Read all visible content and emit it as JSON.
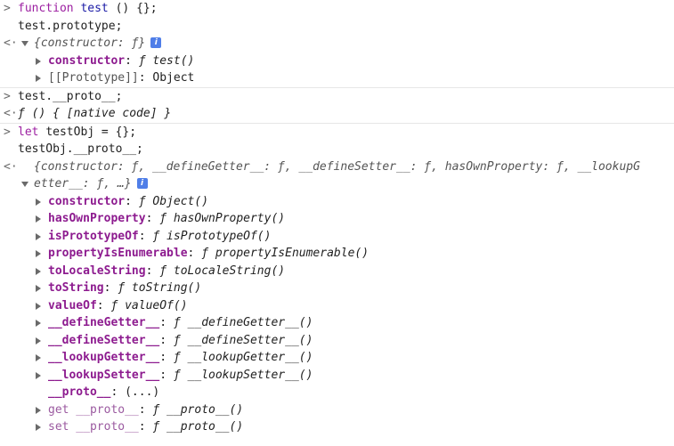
{
  "prompt_symbol": ">",
  "result_symbol": "<·",
  "badge_letter": "i",
  "entries": [
    {
      "input": [
        "function test () {};",
        "test.prototype;"
      ],
      "result_summary": "{constructor: ƒ}",
      "children": [
        {
          "key": "constructor",
          "sep": ": ",
          "value": "ƒ test()"
        },
        {
          "key": "[[Prototype]]",
          "sep": ": ",
          "value": "Object"
        }
      ]
    },
    {
      "input": [
        "test.__proto__;"
      ],
      "result": "ƒ () { [native code] }"
    },
    {
      "input": [
        "let testObj = {};",
        "testObj.__proto__;"
      ],
      "result_summary_line1": "{constructor: ƒ, __defineGetter__: ƒ, __defineSetter__: ƒ, hasOwnProperty: ƒ, __lookupG",
      "result_summary_line2": "etter__: ƒ, …}",
      "children": [
        {
          "key": "constructor",
          "sep": ": ",
          "value": "ƒ Object()"
        },
        {
          "key": "hasOwnProperty",
          "sep": ": ",
          "value": "ƒ hasOwnProperty()"
        },
        {
          "key": "isPrototypeOf",
          "sep": ": ",
          "value": "ƒ isPrototypeOf()"
        },
        {
          "key": "propertyIsEnumerable",
          "sep": ": ",
          "value": "ƒ propertyIsEnumerable()"
        },
        {
          "key": "toLocaleString",
          "sep": ": ",
          "value": "ƒ toLocaleString()"
        },
        {
          "key": "toString",
          "sep": ": ",
          "value": "ƒ toString()"
        },
        {
          "key": "valueOf",
          "sep": ": ",
          "value": "ƒ valueOf()"
        },
        {
          "key": "__defineGetter__",
          "sep": ": ",
          "value": "ƒ __defineGetter__()"
        },
        {
          "key": "__defineSetter__",
          "sep": ": ",
          "value": "ƒ __defineSetter__()"
        },
        {
          "key": "__lookupGetter__",
          "sep": ": ",
          "value": "ƒ __lookupGetter__()"
        },
        {
          "key": "__lookupSetter__",
          "sep": ": ",
          "value": "ƒ __lookupSetter__()"
        },
        {
          "key": "__proto__",
          "sep": ": ",
          "value": "(...)"
        },
        {
          "key": "get __proto__",
          "sep": ": ",
          "value": "ƒ __proto__()"
        },
        {
          "key": "set __proto__",
          "sep": ": ",
          "value": "ƒ __proto__()"
        }
      ]
    }
  ]
}
